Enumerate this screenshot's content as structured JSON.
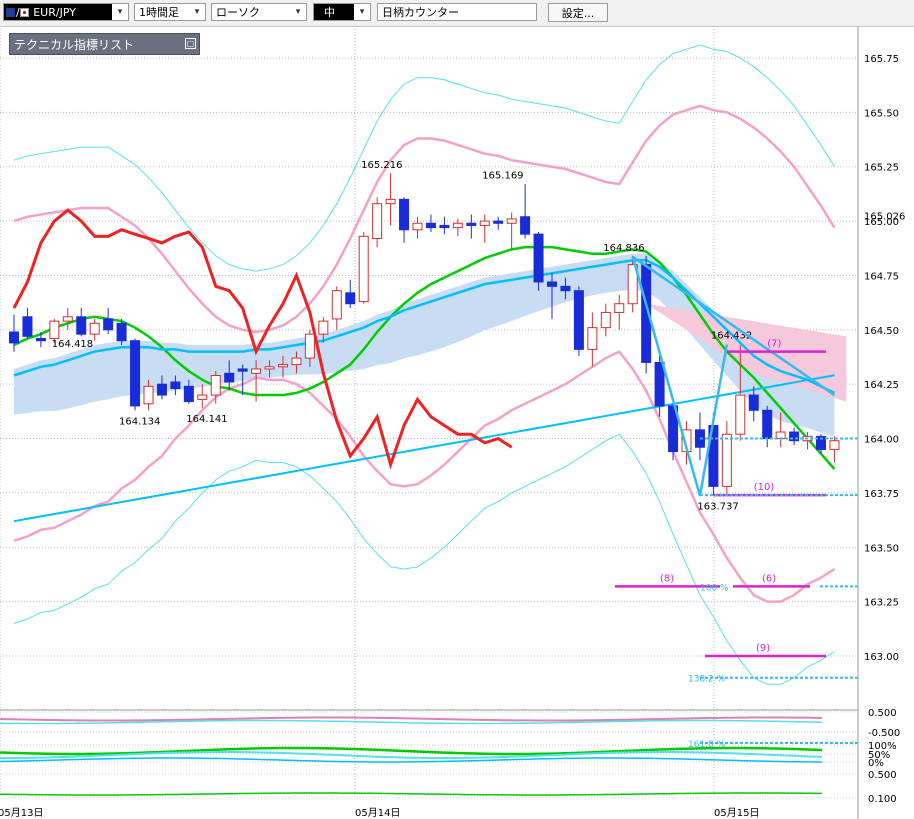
{
  "toolbar": {
    "symbol": "EUR/JPY",
    "timeframe": "1時間足",
    "chart_style": "ローソク",
    "size": "中",
    "counter_label": "日柄カウンター",
    "settings_label": "設定..."
  },
  "indicator_list": {
    "title": "テクニカル指標リスト"
  },
  "colors": {
    "bull_candle": "#d03030",
    "bear_candle": "#1a2cd8",
    "ma_short": "#00cc00",
    "ma_long": "#00bfff",
    "bollinger_outer": "#55e0f0",
    "bollinger_inner": "#f5a0c8",
    "line_red": "#ee2222",
    "cloud": "#c8dcf4",
    "cloud_pink": "#f5c8dc",
    "wave_line": "#33bbee",
    "target_line": "#dd22cc",
    "fib_line": "#33bbee"
  },
  "chart_data": {
    "type": "candlestick",
    "y_ticks": [
      "165.75",
      "165.50",
      "165.25",
      "165.00",
      "164.75",
      "164.50",
      "164.25",
      "164.00",
      "163.75",
      "163.50",
      "163.25",
      "163.00"
    ],
    "current_price": "165.026",
    "x_labels": [
      "05月13日",
      "05月14日",
      "05月15日"
    ],
    "price_labels": [
      {
        "text": "164.418",
        "price": 164.42
      },
      {
        "text": "164.134",
        "price": 164.13
      },
      {
        "text": "164.141",
        "price": 164.14
      },
      {
        "text": "165.216",
        "price": 165.216
      },
      {
        "text": "165.169",
        "price": 165.169
      },
      {
        "text": "164.836",
        "price": 164.836
      },
      {
        "text": "164.432",
        "price": 164.432
      },
      {
        "text": "163.737",
        "price": 163.737
      }
    ],
    "target_labels": [
      "(7)",
      "(10)",
      "(8)",
      "(6)",
      "(9)"
    ],
    "fib_labels": [
      "100 %",
      "138.2 %",
      "161.8 %"
    ],
    "sub_axis_labels": [
      "0.500",
      "-0.500",
      "100%",
      "50%",
      "0%",
      "0.500",
      "0.100"
    ],
    "candles": [
      {
        "o": 164.49,
        "h": 164.57,
        "l": 164.4,
        "c": 164.44
      },
      {
        "o": 164.56,
        "h": 164.6,
        "l": 164.46,
        "c": 164.47
      },
      {
        "o": 164.46,
        "h": 164.49,
        "l": 164.42,
        "c": 164.45
      },
      {
        "o": 164.46,
        "h": 164.55,
        "l": 164.44,
        "c": 164.54
      },
      {
        "o": 164.54,
        "h": 164.6,
        "l": 164.5,
        "c": 164.56
      },
      {
        "o": 164.56,
        "h": 164.6,
        "l": 164.47,
        "c": 164.48
      },
      {
        "o": 164.48,
        "h": 164.55,
        "l": 164.45,
        "c": 164.53
      },
      {
        "o": 164.55,
        "h": 164.6,
        "l": 164.48,
        "c": 164.5
      },
      {
        "o": 164.53,
        "h": 164.55,
        "l": 164.43,
        "c": 164.45
      },
      {
        "o": 164.45,
        "h": 164.46,
        "l": 164.13,
        "c": 164.15
      },
      {
        "o": 164.16,
        "h": 164.27,
        "l": 164.13,
        "c": 164.24
      },
      {
        "o": 164.25,
        "h": 164.29,
        "l": 164.18,
        "c": 164.2
      },
      {
        "o": 164.26,
        "h": 164.29,
        "l": 164.2,
        "c": 164.23
      },
      {
        "o": 164.24,
        "h": 164.27,
        "l": 164.16,
        "c": 164.17
      },
      {
        "o": 164.18,
        "h": 164.25,
        "l": 164.14,
        "c": 164.2
      },
      {
        "o": 164.2,
        "h": 164.31,
        "l": 164.16,
        "c": 164.29
      },
      {
        "o": 164.3,
        "h": 164.36,
        "l": 164.22,
        "c": 164.26
      },
      {
        "o": 164.32,
        "h": 164.34,
        "l": 164.2,
        "c": 164.31
      },
      {
        "o": 164.3,
        "h": 164.36,
        "l": 164.17,
        "c": 164.32
      },
      {
        "o": 164.32,
        "h": 164.36,
        "l": 164.28,
        "c": 164.33
      },
      {
        "o": 164.33,
        "h": 164.38,
        "l": 164.28,
        "c": 164.34
      },
      {
        "o": 164.34,
        "h": 164.4,
        "l": 164.3,
        "c": 164.37
      },
      {
        "o": 164.37,
        "h": 164.5,
        "l": 164.33,
        "c": 164.48
      },
      {
        "o": 164.48,
        "h": 164.56,
        "l": 164.44,
        "c": 164.54
      },
      {
        "o": 164.55,
        "h": 164.7,
        "l": 164.5,
        "c": 164.68
      },
      {
        "o": 164.67,
        "h": 164.73,
        "l": 164.6,
        "c": 164.62
      },
      {
        "o": 164.63,
        "h": 164.95,
        "l": 164.62,
        "c": 164.93
      },
      {
        "o": 164.92,
        "h": 165.11,
        "l": 164.88,
        "c": 165.08
      },
      {
        "o": 165.08,
        "h": 165.22,
        "l": 164.98,
        "c": 165.1
      },
      {
        "o": 165.1,
        "h": 165.11,
        "l": 164.9,
        "c": 164.96
      },
      {
        "o": 164.96,
        "h": 165.02,
        "l": 164.92,
        "c": 164.99
      },
      {
        "o": 164.99,
        "h": 165.03,
        "l": 164.95,
        "c": 164.97
      },
      {
        "o": 164.98,
        "h": 165.02,
        "l": 164.94,
        "c": 164.97
      },
      {
        "o": 164.97,
        "h": 165.01,
        "l": 164.93,
        "c": 164.99
      },
      {
        "o": 164.99,
        "h": 165.03,
        "l": 164.92,
        "c": 164.98
      },
      {
        "o": 164.98,
        "h": 165.03,
        "l": 164.9,
        "c": 165.0
      },
      {
        "o": 165.0,
        "h": 165.02,
        "l": 164.96,
        "c": 164.99
      },
      {
        "o": 164.99,
        "h": 165.04,
        "l": 164.87,
        "c": 165.01
      },
      {
        "o": 165.02,
        "h": 165.17,
        "l": 164.92,
        "c": 164.94
      },
      {
        "o": 164.94,
        "h": 164.95,
        "l": 164.68,
        "c": 164.72
      },
      {
        "o": 164.72,
        "h": 164.76,
        "l": 164.55,
        "c": 164.7
      },
      {
        "o": 164.7,
        "h": 164.74,
        "l": 164.64,
        "c": 164.68
      },
      {
        "o": 164.68,
        "h": 164.7,
        "l": 164.38,
        "c": 164.41
      },
      {
        "o": 164.41,
        "h": 164.58,
        "l": 164.33,
        "c": 164.51
      },
      {
        "o": 164.51,
        "h": 164.62,
        "l": 164.47,
        "c": 164.58
      },
      {
        "o": 164.58,
        "h": 164.66,
        "l": 164.5,
        "c": 164.62
      },
      {
        "o": 164.62,
        "h": 164.84,
        "l": 164.58,
        "c": 164.8
      },
      {
        "o": 164.8,
        "h": 164.84,
        "l": 164.3,
        "c": 164.35
      },
      {
        "o": 164.35,
        "h": 164.4,
        "l": 164.1,
        "c": 164.15
      },
      {
        "o": 164.15,
        "h": 164.18,
        "l": 163.9,
        "c": 163.94
      },
      {
        "o": 163.94,
        "h": 164.08,
        "l": 163.88,
        "c": 164.04
      },
      {
        "o": 164.04,
        "h": 164.12,
        "l": 163.9,
        "c": 163.96
      },
      {
        "o": 164.06,
        "h": 164.12,
        "l": 163.74,
        "c": 163.78
      },
      {
        "o": 163.78,
        "h": 164.08,
        "l": 163.74,
        "c": 164.02
      },
      {
        "o": 164.02,
        "h": 164.43,
        "l": 163.99,
        "c": 164.2
      },
      {
        "o": 164.2,
        "h": 164.24,
        "l": 164.08,
        "c": 164.13
      },
      {
        "o": 164.13,
        "h": 164.15,
        "l": 163.96,
        "c": 164.0
      },
      {
        "o": 164.0,
        "h": 164.12,
        "l": 163.96,
        "c": 164.03
      },
      {
        "o": 164.03,
        "h": 164.05,
        "l": 163.97,
        "c": 163.99
      },
      {
        "o": 163.99,
        "h": 164.03,
        "l": 163.95,
        "c": 164.01
      },
      {
        "o": 164.01,
        "h": 164.02,
        "l": 163.93,
        "c": 163.95
      },
      {
        "o": 163.95,
        "h": 164.01,
        "l": 163.89,
        "c": 163.99
      }
    ],
    "ma_short": [
      164.47,
      164.5,
      164.52,
      164.55,
      164.57,
      164.59,
      164.6,
      164.59,
      164.58,
      164.55,
      164.51,
      164.46,
      164.4,
      164.35,
      164.31,
      164.28,
      164.27,
      164.25,
      164.24,
      164.24,
      164.24,
      164.25,
      164.27,
      164.3,
      164.34,
      164.38,
      164.45,
      164.53,
      164.6,
      164.66,
      164.71,
      164.75,
      164.78,
      164.81,
      164.84,
      164.87,
      164.89,
      164.91,
      164.92,
      164.92,
      164.92,
      164.91,
      164.9,
      164.89,
      164.89,
      164.9,
      164.91,
      164.9,
      164.85,
      164.78,
      164.7,
      164.61,
      164.52,
      164.44,
      164.38,
      164.32,
      164.25,
      164.18,
      164.11,
      164.04,
      163.97,
      163.9
    ],
    "ma_long": [
      164.29,
      164.31,
      164.33,
      164.34,
      164.36,
      164.38,
      164.4,
      164.41,
      164.42,
      164.42,
      164.42,
      164.41,
      164.41,
      164.4,
      164.4,
      164.4,
      164.4,
      164.4,
      164.41,
      164.41,
      164.42,
      164.43,
      164.44,
      164.45,
      164.47,
      164.49,
      164.51,
      164.54,
      164.56,
      164.59,
      164.61,
      164.63,
      164.65,
      164.67,
      164.69,
      164.71,
      164.72,
      164.73,
      164.74,
      164.75,
      164.76,
      164.77,
      164.78,
      164.79,
      164.8,
      164.81,
      164.82,
      164.82,
      164.79,
      164.74,
      164.68,
      164.62,
      164.56,
      164.5,
      164.44,
      164.38,
      164.34,
      164.31,
      164.29,
      164.27,
      164.24,
      164.21
    ],
    "bb_upper_outer": [
      165.28,
      165.3,
      165.31,
      165.32,
      165.33,
      165.34,
      165.34,
      165.34,
      165.3,
      165.26,
      165.2,
      165.13,
      165.05,
      164.97,
      164.9,
      164.84,
      164.8,
      164.78,
      164.77,
      164.78,
      164.8,
      164.84,
      164.9,
      164.98,
      165.08,
      165.2,
      165.33,
      165.46,
      165.56,
      165.63,
      165.66,
      165.66,
      165.65,
      165.63,
      165.61,
      165.59,
      165.58,
      165.56,
      165.55,
      165.54,
      165.53,
      165.52,
      165.5,
      165.48,
      165.46,
      165.45,
      165.55,
      165.65,
      165.72,
      165.77,
      165.79,
      165.81,
      165.79,
      165.78,
      165.75,
      165.71,
      165.66,
      165.6,
      165.53,
      165.44,
      165.35,
      165.25
    ]
  }
}
